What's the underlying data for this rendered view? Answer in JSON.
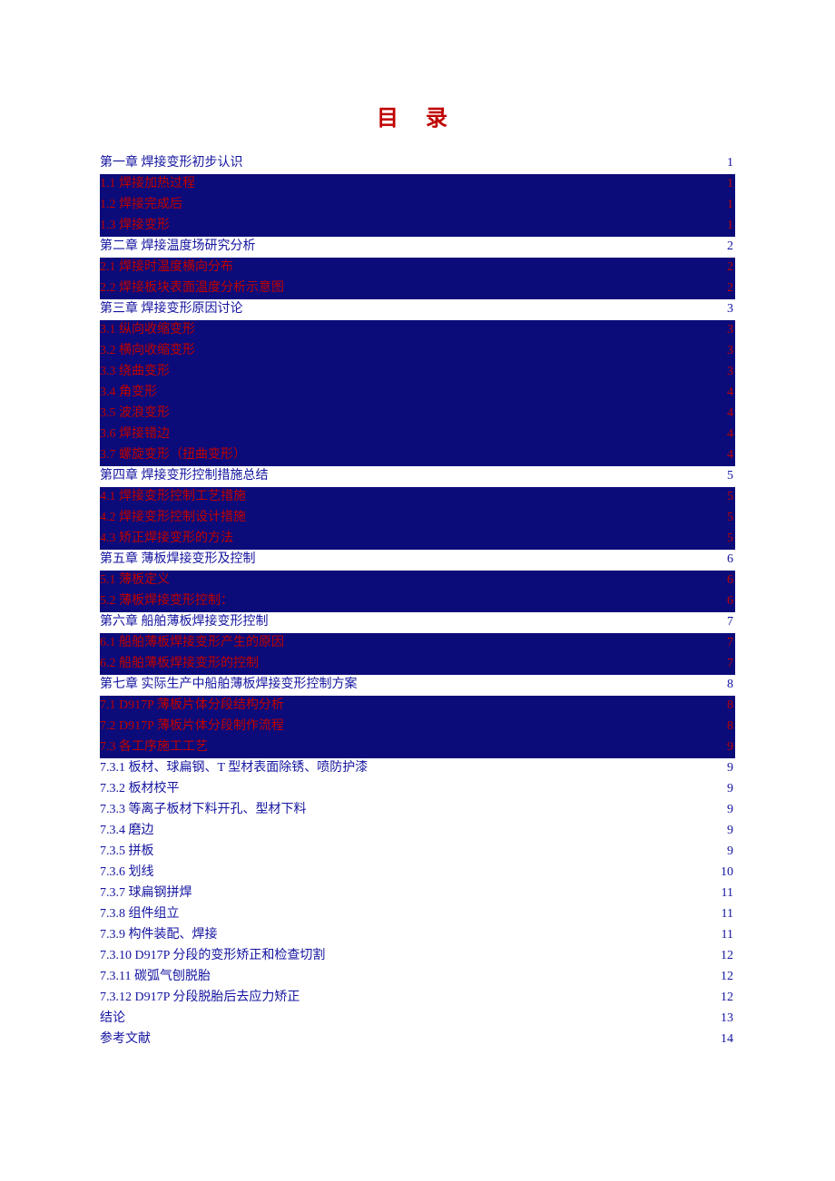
{
  "title": "目 录",
  "toc": [
    {
      "label": "第一章  焊接变形初步认识",
      "page": "1",
      "indent": 1,
      "style": "plain"
    },
    {
      "label": "1.1 焊接加热过程",
      "page": "1",
      "indent": 1,
      "style": "hl"
    },
    {
      "label": "1.2 焊接完成后",
      "page": "1",
      "indent": 1,
      "style": "hl"
    },
    {
      "label": "1.3 焊接变形",
      "page": "1",
      "indent": 1,
      "style": "hl"
    },
    {
      "label": "第二章  焊接温度场研究分析",
      "page": "2",
      "indent": 1,
      "style": "plain"
    },
    {
      "label": "2.1 焊接时温度横向分布",
      "page": "2",
      "indent": 1,
      "style": "hl"
    },
    {
      "label": "2.2 焊接板块表面温度分析示意图",
      "page": "2",
      "indent": 1,
      "style": "hl"
    },
    {
      "label": "第三章  焊接变形原因讨论",
      "page": "3",
      "indent": 1,
      "style": "plain"
    },
    {
      "label": "3.1 纵向收缩变形",
      "page": "3",
      "indent": 1,
      "style": "hl"
    },
    {
      "label": "3.2 横向收缩变形",
      "page": "3",
      "indent": 1,
      "style": "hl"
    },
    {
      "label": "3.3 绕曲变形",
      "page": "3",
      "indent": 1,
      "style": "hl"
    },
    {
      "label": "3.4 角变形",
      "page": "4",
      "indent": 1,
      "style": "hl"
    },
    {
      "label": "3.5 波浪变形",
      "page": "4",
      "indent": 1,
      "style": "hl"
    },
    {
      "label": "3.6 焊接错边",
      "page": "4",
      "indent": 1,
      "style": "hl"
    },
    {
      "label": "3.7 螺旋变形（扭曲变形）",
      "page": "4",
      "indent": 1,
      "style": "hl"
    },
    {
      "label": "第四章  焊接变形控制措施总结",
      "page": "5",
      "indent": 1,
      "style": "plain"
    },
    {
      "label": "4.1 焊接变形控制工艺措施",
      "page": "5",
      "indent": 1,
      "style": "hl"
    },
    {
      "label": "4.2 焊接变形控制设计措施",
      "page": "5",
      "indent": 1,
      "style": "hl"
    },
    {
      "label": "4.3 矫正焊接变形的方法",
      "page": "5",
      "indent": 1,
      "style": "hl"
    },
    {
      "label": "第五章  薄板焊接变形及控制",
      "page": "6",
      "indent": 1,
      "style": "plain"
    },
    {
      "label": "5.1 薄板定义",
      "page": "6",
      "indent": 1,
      "style": "hl"
    },
    {
      "label": "5.2 薄板焊接变形控制：",
      "page": "6",
      "indent": 1,
      "style": "hl"
    },
    {
      "label": "第六章  船舶薄板焊接变形控制",
      "page": "7",
      "indent": 1,
      "style": "plain"
    },
    {
      "label": "6.1 船舶薄板焊接变形产生的原因",
      "page": "7",
      "indent": 1,
      "style": "hl"
    },
    {
      "label": "6.2 船舶薄板焊接变形的控制",
      "page": "7",
      "indent": 1,
      "style": "hl"
    },
    {
      "label": "第七章  实际生产中船舶薄板焊接变形控制方案",
      "page": "8",
      "indent": 1,
      "style": "plain"
    },
    {
      "label": "7.1 D917P 薄板片体分段结构分析",
      "page": "8",
      "indent": 1,
      "style": "hl"
    },
    {
      "label": "7.2 D917P 薄板片体分段制作流程",
      "page": "8",
      "indent": 1,
      "style": "hl"
    },
    {
      "label": "7.3 各工序施工工艺",
      "page": "9",
      "indent": 1,
      "style": "hl"
    },
    {
      "label": "7.3.1  板材、球扁钢、T 型材表面除锈、喷防护漆",
      "page": "9",
      "indent": 2,
      "style": "plain"
    },
    {
      "label": "7.3.2  板材校平",
      "page": "9",
      "indent": 2,
      "style": "plain"
    },
    {
      "label": "7.3.3  等离子板材下料开孔、型材下料",
      "page": "9",
      "indent": 2,
      "style": "plain"
    },
    {
      "label": "7.3.4  磨边",
      "page": "9",
      "indent": 2,
      "style": "plain"
    },
    {
      "label": "7.3.5  拼板",
      "page": "9",
      "indent": 2,
      "style": "plain"
    },
    {
      "label": "7.3.6 划线",
      "page": "10",
      "indent": 2,
      "style": "plain"
    },
    {
      "label": "7.3.7  球扁钢拼焊",
      "page": "11",
      "indent": 2,
      "style": "plain"
    },
    {
      "label": "7.3.8 组件组立",
      "page": "11",
      "indent": 2,
      "style": "plain"
    },
    {
      "label": "7.3.9 构件装配、焊接",
      "page": "11",
      "indent": 2,
      "style": "plain"
    },
    {
      "label": "7.3.10 D917P 分段的变形矫正和检查切割",
      "page": "12",
      "indent": 2,
      "style": "plain"
    },
    {
      "label": "7.3.11 碳弧气刨脱胎",
      "page": "12",
      "indent": 2,
      "style": "plain"
    },
    {
      "label": "7.3.12 D917P 分段脱胎后去应力矫正",
      "page": "12",
      "indent": 2,
      "style": "plain"
    },
    {
      "label": "结论",
      "page": "13",
      "indent": 1,
      "style": "plain"
    },
    {
      "label": "参考文献",
      "page": "14",
      "indent": 1,
      "style": "plain"
    }
  ]
}
